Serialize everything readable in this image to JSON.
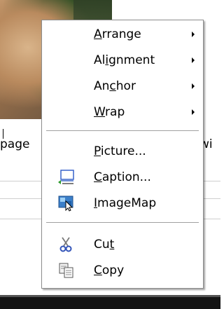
{
  "document": {
    "text_left": "page",
    "text_right": "wi"
  },
  "menu": {
    "items": [
      {
        "label": "Arrange",
        "mnemonic": "A",
        "submenu": true
      },
      {
        "label": "Alignment",
        "mnemonic": "i",
        "submenu": true
      },
      {
        "label": "Anchor",
        "mnemonic": "c",
        "submenu": true
      },
      {
        "label": "Wrap",
        "mnemonic": "W",
        "submenu": true
      },
      {
        "label": "Picture...",
        "mnemonic": "P",
        "submenu": false
      },
      {
        "label": "Caption...",
        "mnemonic": "C",
        "icon": "caption-icon",
        "submenu": false
      },
      {
        "label": "ImageMap",
        "mnemonic": "I",
        "icon": "imagemap-icon",
        "submenu": false
      },
      {
        "label": "Cut",
        "mnemonic": "t",
        "icon": "scissors-icon",
        "submenu": false
      },
      {
        "label": "Copy",
        "mnemonic": "C",
        "icon": "copy-icon",
        "submenu": false
      }
    ]
  }
}
